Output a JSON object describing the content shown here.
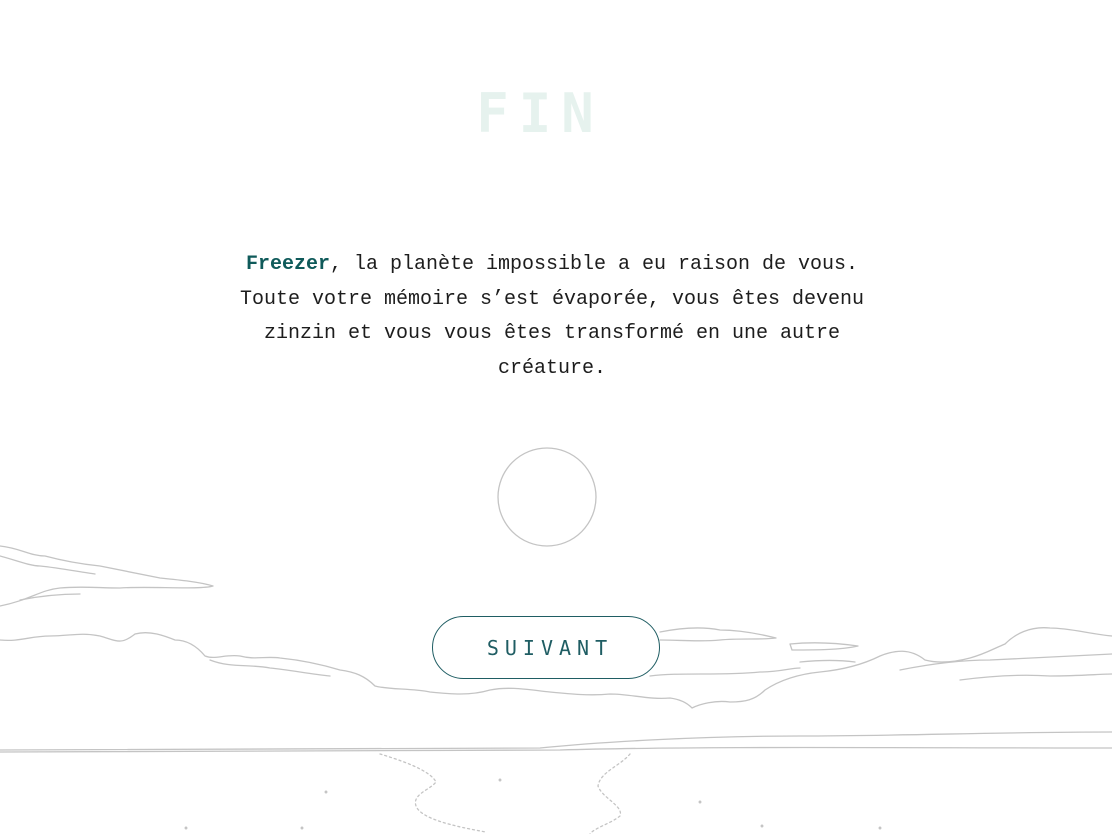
{
  "screen": {
    "title": "FIN",
    "message": {
      "planet_name": "Freezer",
      "text": ", la planète impossible a eu raison de vous. Toute votre mémoire s’est évaporée, vous êtes devenu zinzin et vous vous êtes transformé en une autre créature."
    },
    "next_button_label": "SUIVANT"
  },
  "colors": {
    "accent": "#0f5a5a",
    "title": "#e6f2ee",
    "line_art": "#c4c4c4"
  }
}
